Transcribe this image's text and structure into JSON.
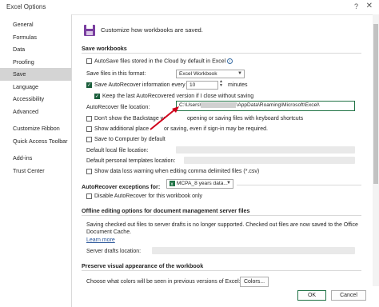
{
  "window": {
    "title": "Excel Options",
    "help": "?",
    "close": "✕"
  },
  "sidebar": {
    "items": [
      {
        "label": "General"
      },
      {
        "label": "Formulas"
      },
      {
        "label": "Data"
      },
      {
        "label": "Proofing"
      },
      {
        "label": "Save"
      },
      {
        "label": "Language"
      },
      {
        "label": "Accessibility"
      },
      {
        "label": "Advanced"
      },
      {
        "label": "Customize Ribbon"
      },
      {
        "label": "Quick Access Toolbar"
      },
      {
        "label": "Add-ins"
      },
      {
        "label": "Trust Center"
      }
    ],
    "selected": "Save"
  },
  "header": {
    "intro": "Customize how workbooks are saved."
  },
  "save_workbooks": {
    "title": "Save workbooks",
    "autosave_label": "AutoSave files stored in the Cloud by default in Excel",
    "format_label": "Save files in this format:",
    "format_value": "Excel Workbook",
    "autorecover_label": "Save AutoRecover information every",
    "autorecover_minutes": "10",
    "minutes_label": "minutes",
    "keep_last_label": "Keep the last AutoRecovered version if I close without saving",
    "file_location_label": "AutoRecover file location:",
    "file_location_prefix": "C:\\Users\\",
    "file_location_suffix": "\\AppData\\Roaming\\Microsoft\\Excel\\",
    "backstage_label_1": "Don't show the Backstage w",
    "backstage_label_2": "opening or saving files with keyboard shortcuts",
    "additional_places_label_1": "Show additional place",
    "additional_places_label_2": "or saving, even if sign-in may be required.",
    "save_to_computer_label": "Save to Computer by default",
    "default_local_label": "Default local file location:",
    "default_templates_label": "Default personal templates location:",
    "data_loss_label": "Show data loss warning when editing comma delimited files (*.csv)"
  },
  "autorecover_exceptions": {
    "title": "AutoRecover exceptions for:",
    "workbook_value": "MCPA_8 years data...",
    "disable_label": "Disable AutoRecover for this workbook only"
  },
  "offline": {
    "title": "Offline editing options for document management server files",
    "text_line1": "Saving checked out files to server drafts is no longer supported. Checked out files are now saved to the Office",
    "text_line2": "Document Cache.",
    "learn_more": "Learn more",
    "drafts_label": "Server drafts location:"
  },
  "preserve": {
    "title": "Preserve visual appearance of the workbook",
    "colors_label": "Choose what colors will be seen in previous versions of Excel:",
    "colors_button": "Colors..."
  },
  "footer": {
    "ok": "OK",
    "cancel": "Cancel"
  },
  "colors": {
    "accent": "#217346",
    "annotation_arrow": "#d0021b",
    "selected_nav": "#d4d4d4"
  }
}
